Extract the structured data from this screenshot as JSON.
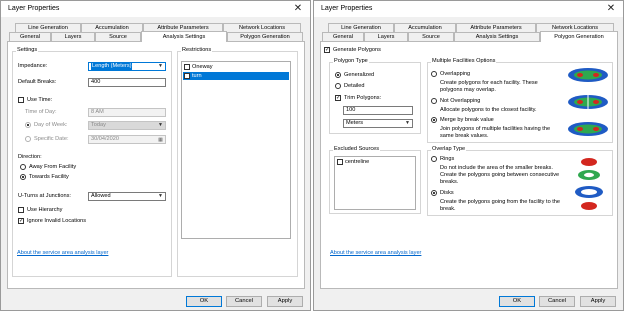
{
  "left_dialog": {
    "title": "Layer Properties",
    "tabs_row1": [
      "Line Generation",
      "Accumulation",
      "Attribute Parameters",
      "Network Locations"
    ],
    "tabs_row2": [
      "General",
      "Layers",
      "Source",
      "Analysis Settings",
      "Polygon Generation"
    ],
    "active_tab": "Analysis Settings",
    "settings": {
      "group_title": "Settings",
      "impedance_label": "Impedance:",
      "impedance_value": "Length (Meters)",
      "default_breaks_label": "Default Breaks:",
      "default_breaks_value": "400",
      "use_time_label": "Use Time:",
      "time_of_day_label": "Time of Day:",
      "time_of_day_value": "8 AM",
      "day_of_week_label": "Day of Week:",
      "day_of_week_value": "Today",
      "specific_date_label": "Specific Date:",
      "specific_date_value": "30/04/2020",
      "direction_label": "Direction:",
      "direction_options": [
        "Away From Facility",
        "Towards Facility"
      ],
      "uturns_label": "U-Turns at Junctions:",
      "uturns_value": "Allowed",
      "use_hierarchy_label": "Use Hierarchy",
      "ignore_invalid_label": "Ignore Invalid Locations"
    },
    "restrictions": {
      "group_title": "Restrictions",
      "items": [
        "Oneway",
        "turn"
      ]
    },
    "about_link": "About the service area analysis layer",
    "buttons": {
      "ok": "OK",
      "cancel": "Cancel",
      "apply": "Apply"
    }
  },
  "right_dialog": {
    "title": "Layer Properties",
    "tabs_row1": [
      "Line Generation",
      "Accumulation",
      "Attribute Parameters",
      "Network Locations"
    ],
    "tabs_row2": [
      "General",
      "Layers",
      "Source",
      "Analysis Settings",
      "Polygon Generation"
    ],
    "active_tab": "Polygon Generation",
    "generate_polygons_label": "Generate Polygons",
    "polygon_type": {
      "group_title": "Polygon Type",
      "options": [
        "Generalized",
        "Detailed"
      ],
      "trim_label": "Trim Polygons:",
      "trim_value": "100",
      "trim_units": "Meters"
    },
    "multiple_facilities": {
      "group_title": "Multiple Facilities Options",
      "overlapping_label": "Overlapping",
      "overlapping_desc": "Create polygons for each facility. These polygons may overlap.",
      "not_overlapping_label": "Not Overlapping",
      "not_overlapping_desc": "Allocate polygons to the closest facility.",
      "merge_label": "Merge by break value",
      "merge_desc": "Join polygons of multiple facilities having the same break values."
    },
    "excluded_sources": {
      "group_title": "Excluded Sources",
      "items": [
        "centreline"
      ]
    },
    "overlap_type": {
      "group_title": "Overlap Type",
      "rings_label": "Rings",
      "rings_desc": "Do not include the area of the smaller breaks. Create the polygons going between consecutive breaks.",
      "disks_label": "Disks",
      "disks_desc": "Create the polygons going from the facility to the break."
    },
    "about_link": "About the service area analysis layer",
    "buttons": {
      "ok": "OK",
      "cancel": "Cancel",
      "apply": "Apply"
    }
  },
  "colors": {
    "accent": "#0078d7",
    "link": "#0066cc",
    "diagram_blue": "#1f5bc4",
    "diagram_green": "#2fa84f",
    "diagram_red": "#d3271f"
  }
}
